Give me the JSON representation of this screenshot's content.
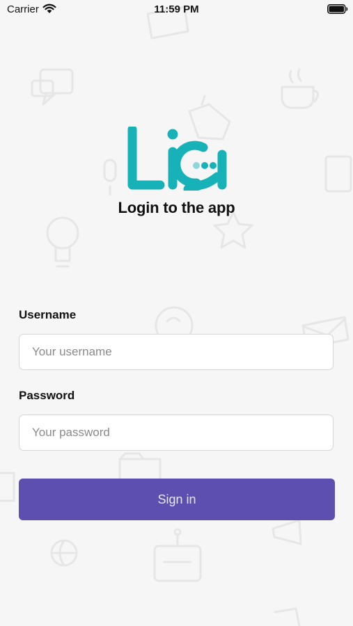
{
  "status_bar": {
    "carrier": "Carrier",
    "time": "11:59 PM",
    "wifi_icon": "wifi-icon",
    "battery_icon": "battery-icon"
  },
  "logo": {
    "text": "Lia",
    "color": "#17b1b8",
    "dot_color": "#8fd6da"
  },
  "page_title": "Login to the app",
  "form": {
    "username_label": "Username",
    "username_placeholder": "Your username",
    "username_value": "",
    "password_label": "Password",
    "password_placeholder": "Your password",
    "password_value": "",
    "signin_label": "Sign in",
    "signin_color": "#5c4fb0"
  }
}
